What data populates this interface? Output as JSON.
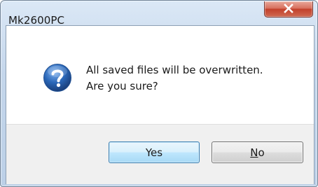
{
  "window": {
    "title": "Mk2600PC",
    "close_icon": "close-icon"
  },
  "message": {
    "icon": "question-icon",
    "line1": "All saved files will be overwritten.",
    "line2": "Are you sure?"
  },
  "buttons": {
    "yes_label": "Yes",
    "no_mnemonic": "N",
    "no_rest": "o"
  },
  "colors": {
    "title_frame": "#c4d6eb",
    "close_button": "#c2402b",
    "question_icon": "#2a67b8",
    "default_button_border": "#3c7fb1"
  }
}
